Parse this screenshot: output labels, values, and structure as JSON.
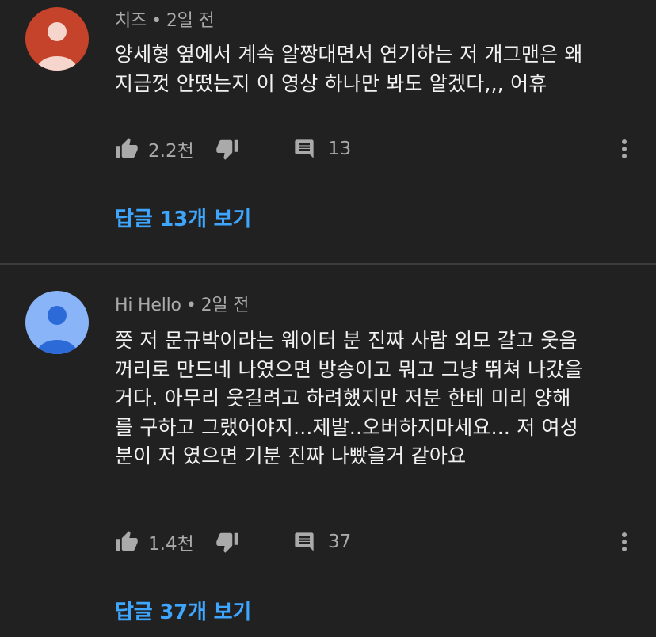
{
  "comments": [
    {
      "author": "치즈",
      "separator": "•",
      "time": "2일 전",
      "avatar_color": "#c5432b",
      "lines": [
        "양세형 옆에서 계속 알짱대면서 연기하는 저 개그맨은 왜",
        "지금껏 안떴는지 이 영상 하나만 봐도 알겠다,,, 어휴"
      ],
      "like_count": "2.2천",
      "reply_count": "13",
      "view_replies": "답글 13개 보기",
      "icons": {
        "like": "thumb-up-icon",
        "dislike": "thumb-down-icon",
        "reply": "comment-icon",
        "more": "more-vert-icon"
      }
    },
    {
      "author": "Hi Hello",
      "separator": "•",
      "time": "2일 전",
      "avatar_color": "#8ab4f8",
      "lines": [
        "쯧 저 문규박이라는 웨이터 분 진짜 사람 외모 갈고 웃음",
        "꺼리로 만드네 나였으면 방송이고 뭐고 그냥 뛰쳐 나갔을",
        "거다. 아무리 웃길려고 하려했지만 저분 한테 미리 양해",
        "를 구하고 그랬어야지...제발..오버하지마세요... 저 여성",
        "분이 저 였으면 기분 진짜 나빴을거 같아요"
      ],
      "like_count": "1.4천",
      "reply_count": "37",
      "view_replies": "답글 37개 보기",
      "icons": {
        "like": "thumb-up-icon",
        "dislike": "thumb-down-icon",
        "reply": "comment-icon",
        "more": "more-vert-icon"
      }
    }
  ],
  "colors": {
    "background": "#212121",
    "link": "#3ea6ff",
    "secondary_text": "#aaaaaa",
    "divider": "#3c3c3c"
  }
}
